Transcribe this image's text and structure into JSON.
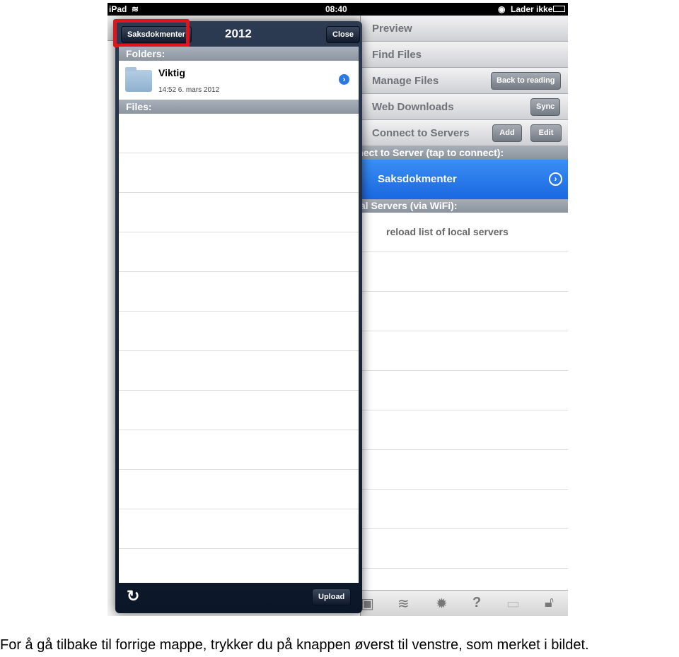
{
  "status_bar": {
    "device": "iPad",
    "time": "08:40",
    "battery_text": "Lader ikke",
    "icons": [
      "wifi-icon",
      "rotation-lock-icon",
      "battery-icon"
    ]
  },
  "right_pane": {
    "menu": [
      {
        "label": "Preview"
      },
      {
        "label": "Find Files"
      },
      {
        "label": "Manage Files",
        "button": "Back to reading"
      },
      {
        "label": "Web Downloads",
        "button": "Sync"
      },
      {
        "label": "Connect to Servers",
        "buttons": [
          "Add",
          "Edit"
        ]
      }
    ],
    "connect_header": "Connect to Server (tap to connect):",
    "selected_server": "Saksdokmenter",
    "local_header": "Local Servers (via WiFi):",
    "reload_label": "reload list of local servers",
    "toolbar_icons": [
      "camera-icon",
      "wifi-icon",
      "gear-icon",
      "help-icon",
      "monitor-icon",
      "unlock-icon"
    ]
  },
  "popover": {
    "back_button": "Saksdokmenter",
    "title": "2012",
    "close_button": "Close",
    "folders_header": "Folders:",
    "folders": [
      {
        "name": "Viktig",
        "date": "14:52 6. mars 2012"
      }
    ],
    "files_header": "Files:",
    "upload_button": "Upload",
    "highlight_color": "#e0141c"
  },
  "caption": "For å gå tilbake til forrige mappe, trykker du på knappen øverst til venstre, som merket i bildet."
}
